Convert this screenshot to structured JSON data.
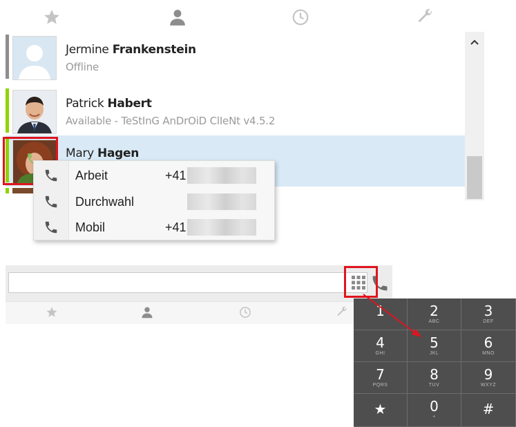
{
  "top_tabs": [
    {
      "id": "favorites",
      "icon": "star-icon"
    },
    {
      "id": "contacts",
      "icon": "person-icon"
    },
    {
      "id": "history",
      "icon": "clock-icon"
    },
    {
      "id": "settings",
      "icon": "wrench-icon"
    }
  ],
  "contacts": [
    {
      "first": "Jermine",
      "last": "Frankenstein",
      "status": "Offline",
      "status_color": "#8e8e8e",
      "avatar": "default-avatar"
    },
    {
      "first": "Patrick",
      "last": "Habert",
      "status": "Available - TeStInG AnDrOiD ClIeNt v4.5.2",
      "status_color": "#8fd400",
      "avatar": "man-photo"
    },
    {
      "first": "Mary",
      "last": "Hagen",
      "status": "",
      "status_color": "#8fd400",
      "avatar": "woman-photo",
      "selected": true
    }
  ],
  "phone_popup": {
    "rows": [
      {
        "label": "Arbeit",
        "number": "+41"
      },
      {
        "label": "Durchwahl",
        "number": ""
      },
      {
        "label": "Mobil",
        "number": "+41"
      }
    ]
  },
  "search": {
    "value": "",
    "placeholder": ""
  },
  "dialpad": {
    "keys": [
      {
        "digit": "1",
        "letters": ""
      },
      {
        "digit": "2",
        "letters": "ABC"
      },
      {
        "digit": "3",
        "letters": "DEF"
      },
      {
        "digit": "4",
        "letters": "GHI"
      },
      {
        "digit": "5",
        "letters": "JKL"
      },
      {
        "digit": "6",
        "letters": "MNO"
      },
      {
        "digit": "7",
        "letters": "PQRS"
      },
      {
        "digit": "8",
        "letters": "TUV"
      },
      {
        "digit": "9",
        "letters": "WXYZ"
      },
      {
        "digit": "★",
        "letters": ""
      },
      {
        "digit": "0",
        "letters": "+"
      },
      {
        "digit": "#",
        "letters": ""
      }
    ]
  },
  "colors": {
    "highlight": "#e0141e",
    "selected_row": "#d9eaf6",
    "dialpad_bg": "#4e4e4e",
    "status_online": "#8fd400",
    "status_offline": "#8e8e8e"
  }
}
